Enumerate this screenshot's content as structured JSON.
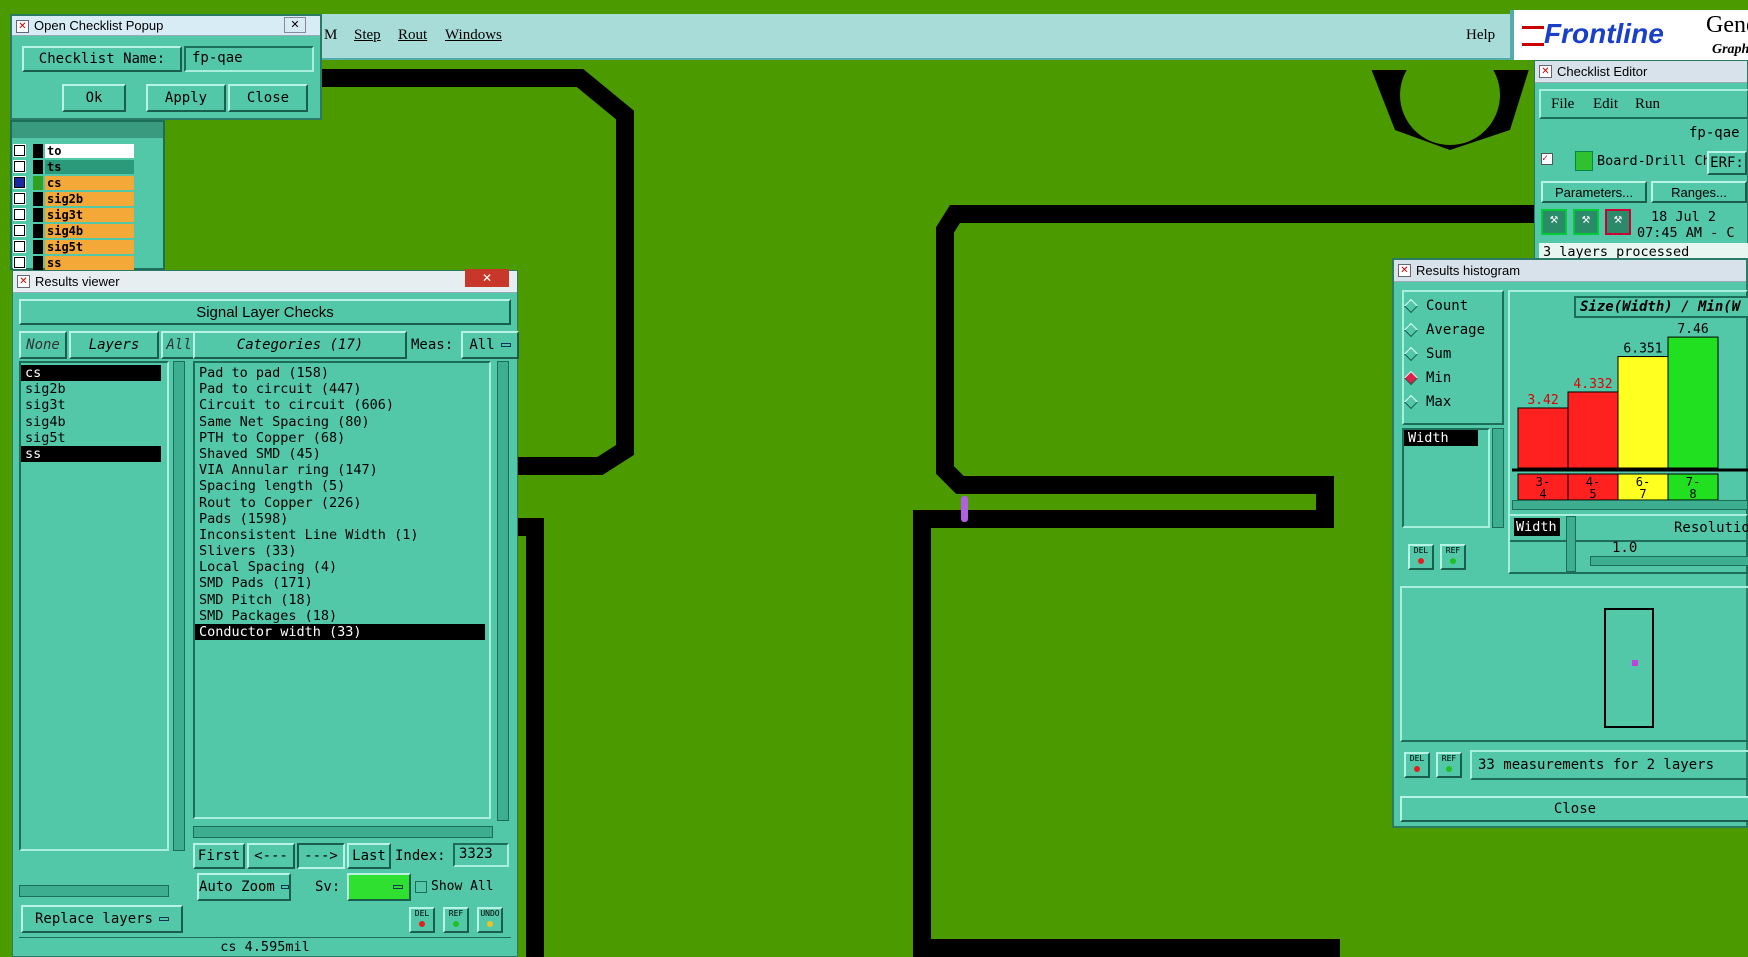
{
  "menubar": {
    "items": [
      "M",
      "Step",
      "Rout",
      "Windows"
    ],
    "help": "Help",
    "brand": "Frontline",
    "brand_right": "Genes",
    "brand_sub": "Graph"
  },
  "checklist_popup": {
    "title": "Open Checklist Popup",
    "name_label": "Checklist Name:",
    "name_value": "fp-qae",
    "ok": "Ok",
    "apply": "Apply",
    "close": "Close"
  },
  "layer_list": [
    {
      "name": "to",
      "color": "#ffffff",
      "checked": false
    },
    {
      "name": "ts",
      "color": "#2a9a7a",
      "checked": false
    },
    {
      "name": "cs",
      "color": "#f4a838",
      "checked": true
    },
    {
      "name": "sig2b",
      "color": "#f4a838",
      "checked": false
    },
    {
      "name": "sig3t",
      "color": "#f4a838",
      "checked": false
    },
    {
      "name": "sig4b",
      "color": "#f4a838",
      "checked": false
    },
    {
      "name": "sig5t",
      "color": "#f4a838",
      "checked": false
    },
    {
      "name": "ss",
      "color": "#f4a838",
      "checked": false
    }
  ],
  "results_viewer": {
    "title": "Results viewer",
    "header": "Signal Layer Checks",
    "none": "None",
    "layers": "Layers",
    "all": "All",
    "categories_btn": "Categories (17)",
    "meas_label": "Meas:",
    "meas_value": "All",
    "layer_rows": [
      {
        "name": "cs",
        "selected": true
      },
      {
        "name": "sig2b",
        "selected": false
      },
      {
        "name": "sig3t",
        "selected": false
      },
      {
        "name": "sig4b",
        "selected": false
      },
      {
        "name": "sig5t",
        "selected": false
      },
      {
        "name": "ss",
        "selected": true
      }
    ],
    "categories": [
      {
        "label": "Pad to pad (158)",
        "selected": false
      },
      {
        "label": "Pad to circuit (447)",
        "selected": false
      },
      {
        "label": "Circuit to circuit (606)",
        "selected": false
      },
      {
        "label": "Same Net Spacing (80)",
        "selected": false
      },
      {
        "label": "PTH to Copper (68)",
        "selected": false
      },
      {
        "label": "Shaved SMD (45)",
        "selected": false
      },
      {
        "label": "VIA Annular ring (147)",
        "selected": false
      },
      {
        "label": "Spacing length (5)",
        "selected": false
      },
      {
        "label": "Rout to Copper (226)",
        "selected": false
      },
      {
        "label": "Pads (1598)",
        "selected": false
      },
      {
        "label": "Inconsistent Line Width (1)",
        "selected": false
      },
      {
        "label": "Slivers (33)",
        "selected": false
      },
      {
        "label": "Local Spacing (4)",
        "selected": false
      },
      {
        "label": "SMD Pads (171)",
        "selected": false
      },
      {
        "label": "SMD Pitch (18)",
        "selected": false
      },
      {
        "label": "SMD Packages (18)",
        "selected": false
      },
      {
        "label": "Conductor width (33)",
        "selected": true
      }
    ],
    "first": "First",
    "prev": "<---",
    "next": "--->",
    "last": "Last",
    "index_label": "Index:",
    "index_value": "3323",
    "auto_zoom": "Auto Zoom",
    "sv_label": "Sv:",
    "show_all": "Show All",
    "replace_layers": "Replace layers",
    "del": "DEL",
    "ref": "REF",
    "undo": "UNDO",
    "status": "cs 4.595mil"
  },
  "checklist_editor": {
    "title": "Checklist Editor",
    "menu": [
      "File",
      "Edit",
      "Run"
    ],
    "name": "fp-qae",
    "check_name": "Board-Drill Che",
    "erf": "ERF:",
    "parameters": "Parameters...",
    "ranges": "Ranges...",
    "date": "18 Jul 2",
    "time": "07:45 AM - C",
    "status": "3 layers processed"
  },
  "histogram": {
    "title": "Results histogram",
    "modes": [
      {
        "label": "Count",
        "on": false
      },
      {
        "label": "Average",
        "on": false
      },
      {
        "label": "Sum",
        "on": false
      },
      {
        "label": "Min",
        "on": true
      },
      {
        "label": "Max",
        "on": false
      }
    ],
    "field": "Width",
    "chart_title": "Size(Width) / Min(W",
    "resolution_label": "Resolutio",
    "resolution_value": "1.0",
    "width_tag": "Width",
    "measurements": "33 measurements for 2 layers",
    "close": "Close",
    "del": "DEL",
    "ref": "REF"
  },
  "chart_data": {
    "type": "bar",
    "title": "Size(Width) / Min(W",
    "categories": [
      "3-4",
      "4-5",
      "6-7",
      "7-8"
    ],
    "values": [
      3.42,
      4.332,
      6.351,
      7.46
    ],
    "value_labels": [
      "3.42",
      "4.332",
      "6.351",
      "7.46"
    ],
    "colors": [
      "#ff2020",
      "#ff2020",
      "#ffff20",
      "#20e020"
    ],
    "label_colors": [
      "#e00000",
      "#e00000",
      "#000000",
      "#000000"
    ],
    "ylim": [
      0,
      8
    ]
  }
}
